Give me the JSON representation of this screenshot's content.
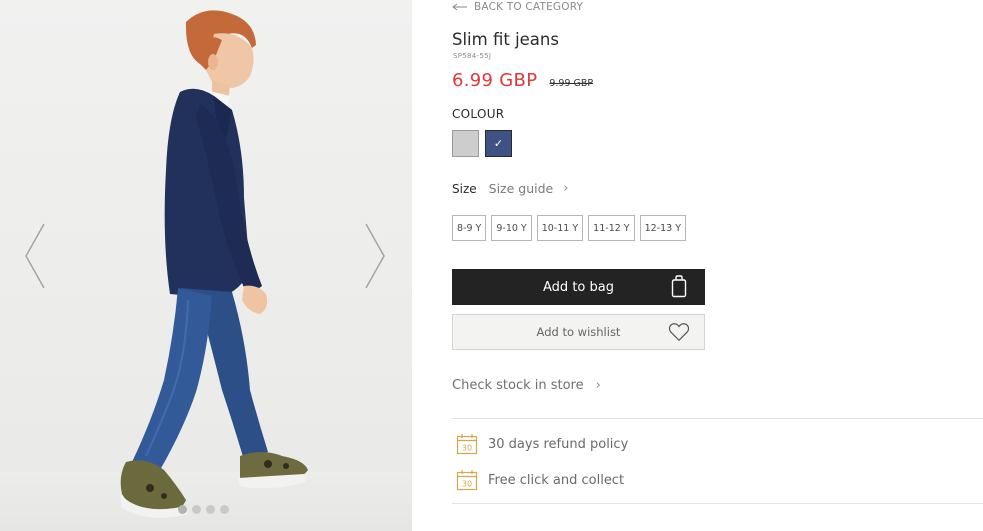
{
  "gallery": {
    "prev_icon": "chevron-left-icon",
    "next_icon": "chevron-right-icon",
    "dots_count": 4,
    "active_dot": 0
  },
  "product": {
    "back_label": "BACK TO CATEGORY",
    "title": "Slim fit jeans",
    "sku": "SP584-55J",
    "price_new": "6.99 GBP",
    "price_old": "9.99 GBP",
    "colour_label": "COLOUR",
    "colours": [
      {
        "name": "grey",
        "hex": "#cdcdcd",
        "selected": false
      },
      {
        "name": "navy",
        "hex": "#3e5283",
        "selected": true
      }
    ],
    "size_label": "Size",
    "size_guide_label": "Size guide",
    "sizes": [
      "8-9 Y",
      "9-10 Y",
      "10-11 Y",
      "11-12 Y",
      "12-13 Y"
    ],
    "add_to_bag_label": "Add to bag",
    "add_to_wishlist_label": "Add to wishlist",
    "check_stock_label": "Check stock in store",
    "features": [
      {
        "icon": "calendar-30-icon",
        "label": "30 days refund policy"
      },
      {
        "icon": "calendar-30-icon",
        "label": "Free click and collect"
      }
    ],
    "calendar_number": "30"
  },
  "colors": {
    "price_red": "#e2373c",
    "button_dark": "#232323",
    "icon_gold": "#d8a64a"
  }
}
